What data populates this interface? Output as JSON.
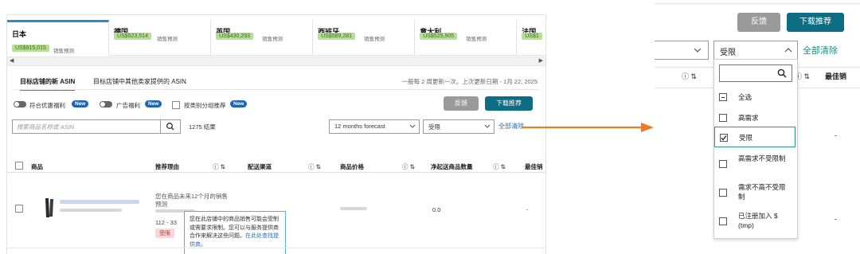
{
  "marketplace_tabs": [
    {
      "name": "日本",
      "value": "US$915,015",
      "forecast": "销售预测",
      "active": true
    },
    {
      "name": "德国",
      "value": "US$523,514",
      "forecast": "销售预测"
    },
    {
      "name": "英国",
      "value": "US$430,293",
      "forecast": "销售预测"
    },
    {
      "name": "西班牙",
      "value": "US$589,281",
      "forecast": "销售预测"
    },
    {
      "name": "意大利",
      "value": "US$525,905",
      "forecast": "销售预测"
    },
    {
      "name": "法国",
      "value": "US$1",
      "forecast": ""
    }
  ],
  "scroll": {
    "left": "◀",
    "right": "▶"
  },
  "subtabs": {
    "target_asin": "目标店铺的新 ASIN",
    "other_asin": "目标店铺中其他卖家提供的 ASIN"
  },
  "update_text": "一般每 2 周更新一次。上次更新日期 - 1月 22, 2025",
  "filters": {
    "promo_label": "符合优惠福利",
    "ad_label": "广告福利",
    "new_badge": "New",
    "category_label": "按类别分组推荐"
  },
  "actions": {
    "feedback": "反馈",
    "download": "下载推荐",
    "clear_all": "全部清除"
  },
  "search": {
    "placeholder": "搜索商品名称或 ASIN",
    "results": "1275 结果"
  },
  "forecast_select": "12 months forecast",
  "restrict_select": "受限",
  "columns": {
    "product": "商品",
    "reason": "推荐理由",
    "channel": "配送渠道",
    "price": "商品价格",
    "net_sales": "净起送商品数量",
    "best": "最佳销"
  },
  "row": {
    "reason_line1": "您在商品未来12个月的销售",
    "reason_line2": "预测",
    "reason_line3": "112 - 33",
    "tag": "受限",
    "net_sales": "0.0",
    "best": "-"
  },
  "tooltip": {
    "text": "您在此店铺中的商品销售可能会受制或需要求限制。您可以与服务提供商合作来解决这些问题。",
    "link": "在此处查找提供商。"
  },
  "right_panel": {
    "feedback": "反馈",
    "download": "下载推荐",
    "select_value": "受限",
    "clear_all": "全部清除",
    "best_col": "最佳销",
    "dash1": "-",
    "dash2": "-",
    "options": [
      {
        "label": "全选",
        "state": "partial"
      },
      {
        "label": "高需求",
        "state": "unchecked"
      },
      {
        "label": "受限",
        "state": "checked"
      },
      {
        "label": "高需求不受限制",
        "state": "unchecked"
      },
      {
        "label": "需求不高不受限制",
        "state": "unchecked"
      },
      {
        "label": "已注册加入 $ (tmp)",
        "state": "unchecked"
      }
    ]
  },
  "colors": {
    "accent_blue": "#2c8ad1",
    "teal_button": "#0d6d85",
    "grey_button": "#9a9a9a",
    "badge_green": "#b8dd95",
    "new_blue": "#1c64b8",
    "arrow_orange": "#f07a21",
    "tag_red": "#c0392b"
  }
}
